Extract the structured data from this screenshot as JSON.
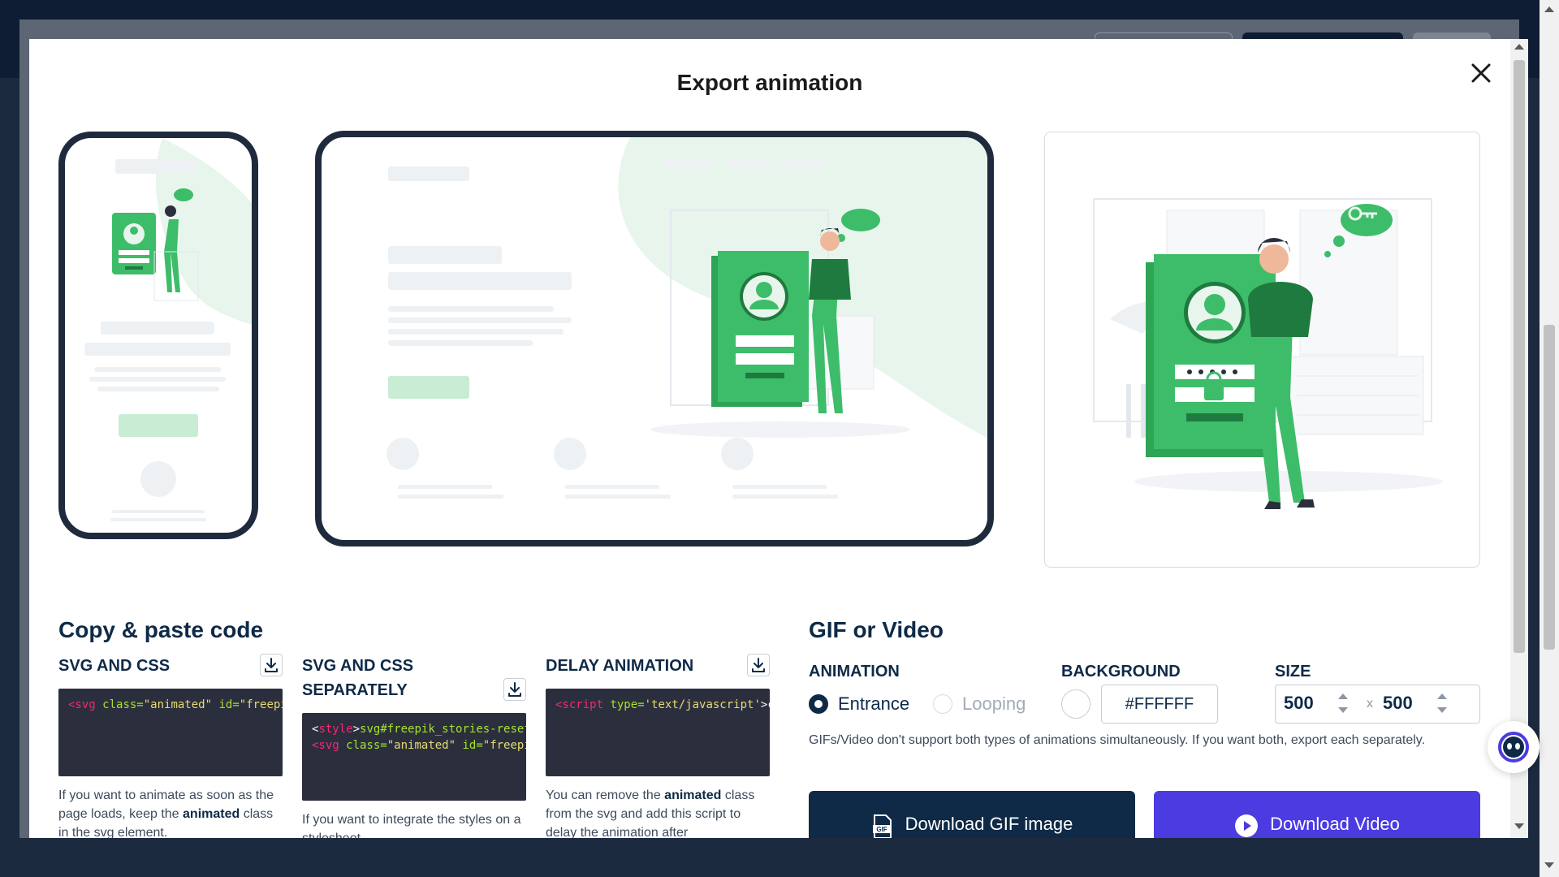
{
  "modal": {
    "title": "Export animation"
  },
  "copy_paste": {
    "title": "Copy & paste code",
    "columns": [
      {
        "label": "SVG AND CSS",
        "code_lines": [
          [
            [
              "tag",
              "<svg "
            ],
            [
              "attr",
              "class="
            ],
            [
              "val",
              "\"animated\""
            ],
            [
              "plain",
              " "
            ],
            [
              "attr",
              "id="
            ],
            [
              "val",
              "\"freepi"
            ]
          ]
        ],
        "help_parts": [
          [
            "text",
            "If you want to animate as soon as the page loads, keep the "
          ],
          [
            "bold",
            "animated"
          ],
          [
            "text",
            " class in the svg element."
          ]
        ]
      },
      {
        "label": "SVG AND CSS SEPARATELY",
        "code_lines": [
          [
            [
              "plain",
              "<"
            ],
            [
              "tag",
              "style"
            ],
            [
              "plain",
              ">"
            ],
            [
              "attr",
              "svg#freepik_stories-reset"
            ]
          ],
          [
            [
              "tag",
              "<svg "
            ],
            [
              "attr",
              "class="
            ],
            [
              "val",
              "\"animated\""
            ],
            [
              "plain",
              " "
            ],
            [
              "attr",
              "id="
            ],
            [
              "val",
              "\"freepi"
            ]
          ]
        ],
        "help_parts": [
          [
            "text",
            "If you want to integrate the styles on a stylesheet"
          ]
        ]
      },
      {
        "label": "DELAY ANIMATION",
        "code_lines": [
          [
            [
              "tag",
              "<script "
            ],
            [
              "attr",
              "type="
            ],
            [
              "val",
              "'text/javascript'"
            ],
            [
              "plain",
              ">c"
            ]
          ]
        ],
        "help_parts": [
          [
            "text",
            "You can remove the "
          ],
          [
            "bold",
            "animated"
          ],
          [
            "text",
            " class from the svg and add this script to delay the animation after"
          ]
        ]
      }
    ]
  },
  "gif_video": {
    "title": "GIF or Video",
    "animation_label": "ANIMATION",
    "animation_options": [
      "Entrance",
      "Looping"
    ],
    "animation_selected": "Entrance",
    "background_label": "BACKGROUND",
    "background_value": "#FFFFFF",
    "size_label": "SIZE",
    "size_width": "500",
    "size_times": "x",
    "size_height": "500",
    "note": "GIFs/Video don't support both types of animations simultaneously. If you want both, export each separately.",
    "gif_button": "Download GIF image",
    "gif_badge": "GIF",
    "video_button": "Download Video"
  },
  "colors": {
    "navy": "#0e2a47",
    "green": "#3dbd6a",
    "video_button": "#4b3be0",
    "code_bg": "#2b2f3d"
  }
}
